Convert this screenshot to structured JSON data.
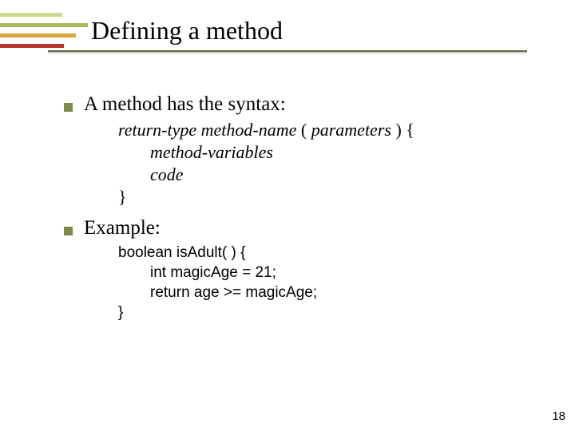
{
  "title": "Defining a method",
  "point1": "A method has the syntax:",
  "syntax": {
    "line1_a": "return-type  method-name",
    "line1_b": " ( ",
    "line1_c": "parameters",
    "line1_d": " ) {",
    "line2": "method-variables",
    "line3": "code",
    "line4": "}"
  },
  "point2": "Example:",
  "example": {
    "line1": "boolean isAdult( ) {",
    "line2": "int magicAge = 21;",
    "line3": "return age >= magicAge;",
    "line4": "}"
  },
  "pageNumber": "18"
}
